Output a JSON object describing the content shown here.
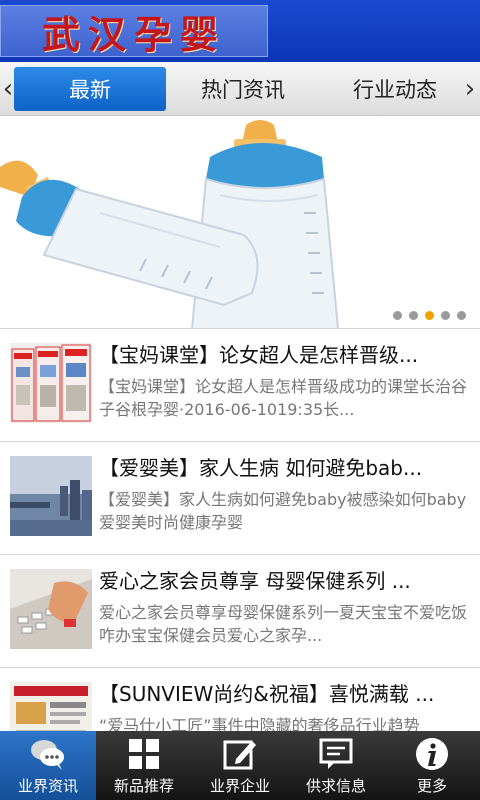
{
  "header": {
    "logo_text": "武汉孕婴"
  },
  "tabs": [
    {
      "label": "最新",
      "active": true
    },
    {
      "label": "热门资讯",
      "active": false
    },
    {
      "label": "行业动态",
      "active": false
    }
  ],
  "banner": {
    "slides": 5,
    "active_slide": 3
  },
  "news": [
    {
      "title": "【宝妈课堂】论女超人是怎样晋级...",
      "desc": "【宝妈课堂】论女超人是怎样晋级成功的课堂长治谷子谷根孕婴·2016-06-1019:35长..."
    },
    {
      "title": "【爱婴美】家人生病 如何避免bab...",
      "desc": "【爱婴美】家人生病如何避免baby被感染如何baby爱婴美时尚健康孕婴"
    },
    {
      "title": "爱心之家会员尊享 母婴保健系列 ...",
      "desc": "爱心之家会员尊享母婴保健系列一夏天宝宝不爱吃饭咋办宝宝保健会员爱心之家孕..."
    },
    {
      "title": "【SUNVIEW尚约&祝福】喜悦满载 ...",
      "desc": "“爱马仕小工匠”事件中隐藏的奢侈品行业趋势"
    }
  ],
  "bottom_nav": [
    {
      "label": "业界资讯",
      "icon": "chat-bubbles-icon",
      "active": true
    },
    {
      "label": "新品推荐",
      "icon": "grid-icon",
      "active": false
    },
    {
      "label": "业界企业",
      "icon": "edit-icon",
      "active": false
    },
    {
      "label": "供求信息",
      "icon": "message-icon",
      "active": false
    },
    {
      "label": "更多",
      "icon": "info-icon",
      "active": false
    }
  ],
  "colors": {
    "header_blue": "#1b4ad1",
    "tab_active": "#1a72d8",
    "dot_active": "#f0a100",
    "nav_active": "#2d75c9"
  }
}
